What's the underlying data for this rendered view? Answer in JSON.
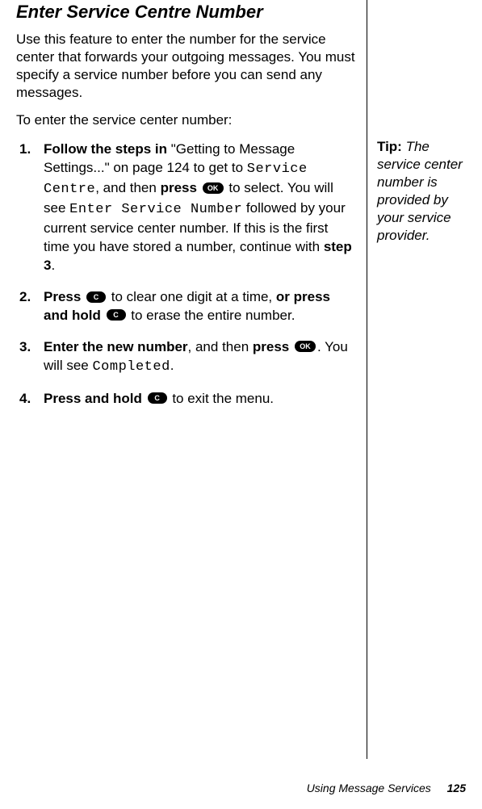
{
  "heading": "Enter Service Centre Number",
  "intro": "Use this feature to enter the number for the service center that forwards your outgoing messages. You must specify a service number before you can send any messages.",
  "lead_in": "To enter the service center number:",
  "key_labels": {
    "ok": "OK",
    "c": "C"
  },
  "step1": {
    "t1": "Follow the steps in ",
    "t2": "\"Getting to Message Settings...\" on page 124 to get to ",
    "lcd1": "Service Centre",
    "t3": ", and then ",
    "b2": "press ",
    "t4": " to select. You will see ",
    "lcd2": "Enter Service Number",
    "t5": " followed by your current service center number. If this is the first time you have stored a number, continue with ",
    "b3": "step 3",
    "t6": "."
  },
  "step2": {
    "b1": "Press ",
    "t1": " to clear one digit at a time, ",
    "b2": "or press and hold ",
    "t2": " to erase the entire number."
  },
  "step3": {
    "b1": "Enter the new number",
    "t1": ", and then ",
    "b2": "press ",
    "t2": ". You will see ",
    "lcd1": "Completed",
    "t3": "."
  },
  "step4": {
    "b1": "Press and hold ",
    "t1": " to exit the menu."
  },
  "tip": {
    "label": "Tip: ",
    "text": "The service center number is provided by your service provider."
  },
  "footer": {
    "text": "Using Message Services",
    "page": "125"
  }
}
